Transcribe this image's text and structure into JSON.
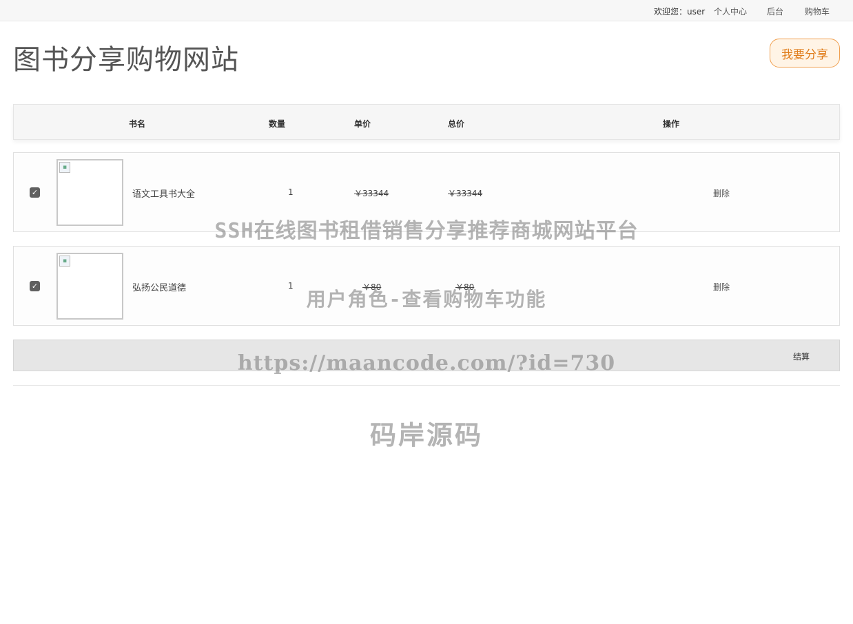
{
  "topbar": {
    "welcome": "欢迎您：user",
    "links": [
      "个人中心",
      "后台",
      "购物车"
    ]
  },
  "header": {
    "site_title": "图书分享购物网站",
    "share_button": "我要分享"
  },
  "cart": {
    "columns": [
      "书名",
      "数量",
      "单价",
      "总价",
      "操作"
    ],
    "rows": [
      {
        "checked": "✓",
        "name": "语文工具书大全",
        "qty": "1",
        "unit_price": "￥33344",
        "total_price": "￥33344",
        "action": "删除"
      },
      {
        "checked": "✓",
        "name": "弘扬公民道德",
        "qty": "1",
        "unit_price": "￥80",
        "total_price": "￥80",
        "action": "删除"
      }
    ],
    "checkout_label": "结算"
  },
  "watermark": {
    "line1": "SSH在线图书租借销售分享推荐商城网站平台",
    "line2": "用户角色-查看购物车功能",
    "line3": "https://maancode.com/?id=730",
    "line4": "码岸源码"
  },
  "colors": {
    "accent_orange": "#e07c1a",
    "topbar_bg": "#f7f7f7",
    "checkout_bg": "#e6e6e6"
  }
}
